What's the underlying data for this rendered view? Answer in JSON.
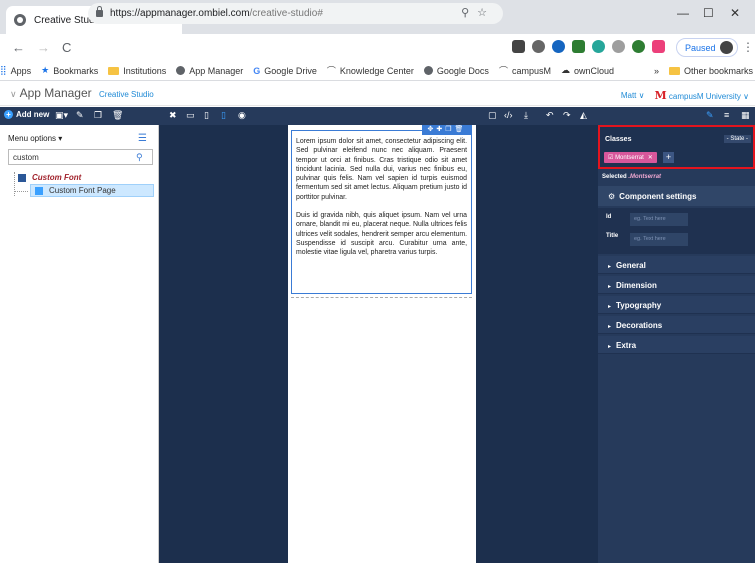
{
  "browser": {
    "tab_title": "Creative Studio",
    "url_host": "https://appmanager.ombiel.com",
    "url_path": "/creative-studio#",
    "profile_status": "Paused",
    "bookmarks": [
      "Apps",
      "Bookmarks",
      "Institutions",
      "App Manager",
      "Google Drive",
      "Knowledge Center",
      "Google Docs",
      "campusM",
      "ownCloud"
    ],
    "overflow": "»",
    "other_bookmarks": "Other bookmarks"
  },
  "header": {
    "title": "App Manager",
    "subtitle": "Creative Studio",
    "user": "Matt",
    "logo_letter": "M",
    "org": "campusM University"
  },
  "toolbar": {
    "add_new": "Add new"
  },
  "left_panel": {
    "menu_options": "Menu options",
    "search_value": "custom",
    "tree": [
      {
        "label": "Custom Font"
      },
      {
        "label": "Custom Font Page"
      }
    ]
  },
  "canvas": {
    "paragraph1": "Lorem ipsum dolor sit amet, consectetur adipiscing elit. Sed pulvinar eleifend nunc nec aliquam. Praesent tempor ut orci at finibus. Cras tristique odio sit amet tincidunt lacinia. Sed nulla dui, varius nec finibus eu, pulvinar quis felis. Nam vel sapien id turpis euismod fermentum sed sit amet lectus. Aliquam pretium justo id porttitor pulvinar.",
    "paragraph2": "Duis id gravida nibh, quis aliquet ipsum. Nam vel urna ornare, blandit mi eu, placerat neque. Nulla ultrices felis ultrices velit sodales, hendrerit semper arcu elementum. Suspendisse id suscipit arcu. Curabitur urna ante, molestie vitae ligula vel, pharetra varius turpis."
  },
  "right_panel": {
    "classes_label": "Classes",
    "state_label": "- State -",
    "class_tag": "Montserrat",
    "selected_prefix": "Selected",
    "selected_class": ".Montserrat",
    "component_settings": "Component settings",
    "id_label": "Id",
    "title_label": "Title",
    "placeholder": "eg. Text here",
    "sections": [
      "General",
      "Dimension",
      "Typography",
      "Decorations",
      "Extra"
    ]
  },
  "colors": {
    "toolbar_bg": "#263a5b",
    "canvas_bg": "#1c2f4d",
    "accent": "#3a7bd5",
    "tag": "#d8579b",
    "highlight_border": "#e3141e"
  }
}
